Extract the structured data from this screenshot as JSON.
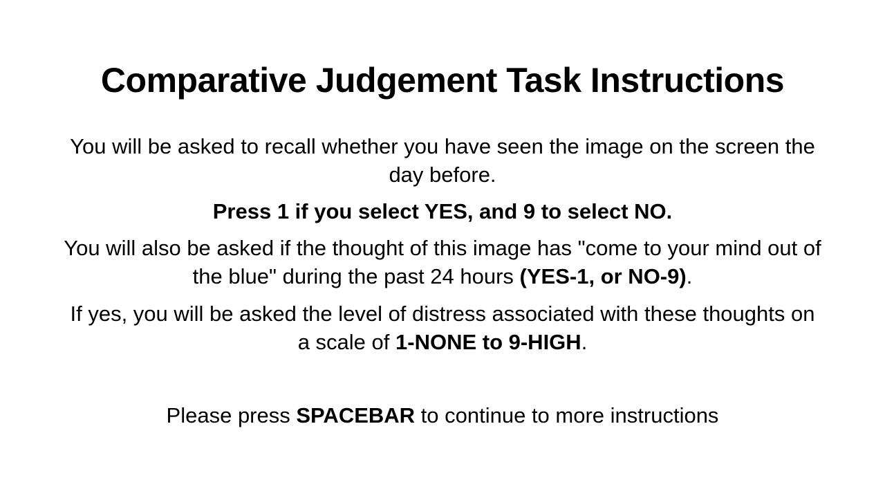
{
  "title": "Comparative Judgement Task Instructions",
  "instructions": {
    "recall": "You will be asked to recall whether you have seen the image on the screen the day before.",
    "keys": "Press 1 if you select YES, and 9 to select NO.",
    "intrusion_text": "You will also be asked if the thought of this image has \"come to your mind out of the blue\" during the past 24 hours ",
    "intrusion_keys": "(YES-1, or NO-9)",
    "intrusion_end": ".",
    "distress_text": "If yes, you will be asked the level of distress associated with these thoughts on a scale of ",
    "distress_scale": "1-NONE to 9-HIGH",
    "distress_end": "."
  },
  "continue": {
    "prefix": "Please press ",
    "key": "SPACEBAR",
    "suffix": " to continue to more instructions"
  }
}
